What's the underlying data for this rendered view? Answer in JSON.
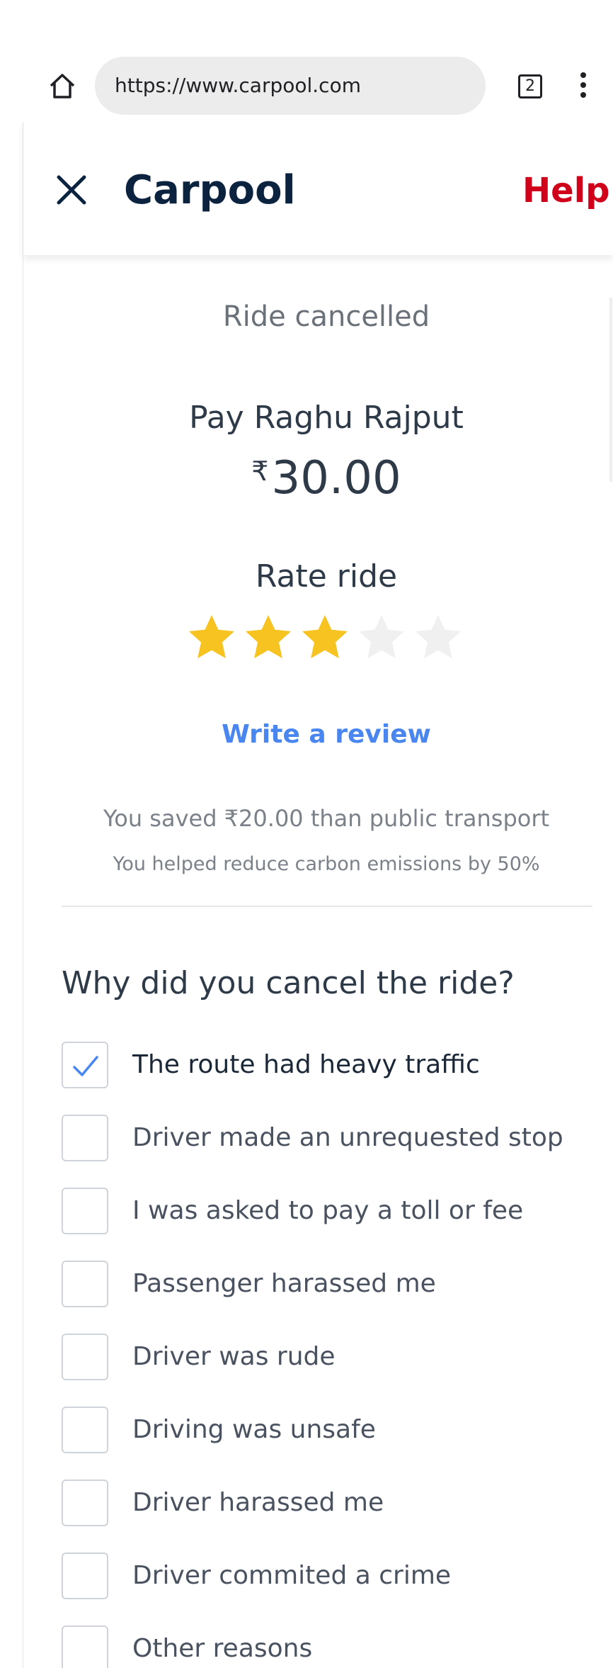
{
  "browser": {
    "url": "https://www.carpool.com",
    "tab_count": "2"
  },
  "header": {
    "title": "Carpool",
    "help_label": "Help"
  },
  "ride": {
    "status": "Ride cancelled",
    "pay_label": "Pay Raghu Rajput",
    "currency_symbol": "₹",
    "amount": "30.00",
    "rate_label": "Rate ride",
    "rating": 3,
    "rating_max": 5,
    "write_review_label": "Write a review",
    "savings_text": "You saved ₹20.00 than public transport",
    "carbon_text": "You helped reduce carbon emissions by 50%"
  },
  "cancel_reasons": {
    "question": "Why did you cancel the ride?",
    "options": [
      {
        "label": "The route had heavy traffic",
        "checked": true
      },
      {
        "label": "Driver made an unrequested stop",
        "checked": false
      },
      {
        "label": "I was asked to pay a toll or fee",
        "checked": false
      },
      {
        "label": "Passenger harassed me",
        "checked": false
      },
      {
        "label": "Driver was rude",
        "checked": false
      },
      {
        "label": "Driving was unsafe",
        "checked": false
      },
      {
        "label": "Driver harassed me",
        "checked": false
      },
      {
        "label": "Driver commited a crime",
        "checked": false
      },
      {
        "label": "Other reasons",
        "checked": false
      }
    ]
  },
  "colors": {
    "brand_navy": "#0c2340",
    "help_red": "#d0021b",
    "link_blue": "#4a86f0",
    "star_filled": "#f6c321",
    "star_empty": "#f0f0f0",
    "check_blue": "#4a86f0"
  },
  "icons": {
    "home": "home-icon",
    "tabs": "tabs-icon",
    "menu": "more-vert-icon",
    "close": "close-icon",
    "star": "star-icon",
    "check": "checkmark-icon"
  }
}
